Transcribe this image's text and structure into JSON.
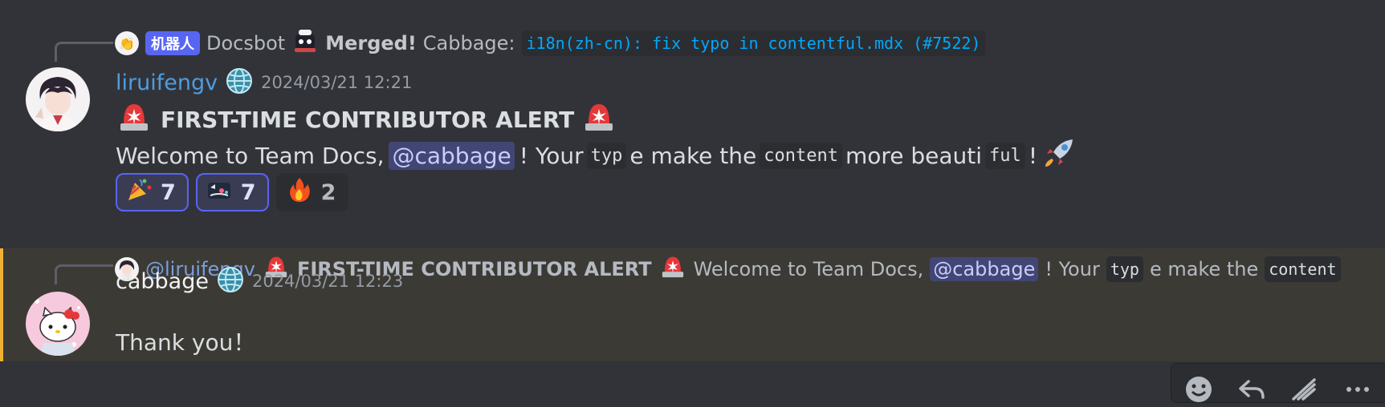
{
  "colors": {
    "background": "#323339",
    "highlight_bg": "#3c3a35",
    "highlight_bar": "#f0b232",
    "mention_bg": "#414675",
    "link_blue": "#00a8fc",
    "username_blue": "#4d9de0"
  },
  "message1": {
    "reply": {
      "bot_tag": "机器人",
      "author": "Docsbot",
      "merged": "Merged!",
      "prefix": "Cabbage:",
      "commit": "i18n(zh-cn): fix typo in contentful.mdx (#7522)"
    },
    "author": "liruifengv",
    "timestamp": "2024/03/21 12:21",
    "title": "FIRST-TIME CONTRIBUTOR ALERT",
    "body": {
      "part1": "Welcome to Team Docs,",
      "mention": "@cabbage",
      "part2": "! Your",
      "code1": "typ",
      "part3": "e make the",
      "code2": "content",
      "part4": "more beauti",
      "code3": "ful",
      "part5": "!"
    },
    "reactions": [
      {
        "emoji": "party-popper-icon",
        "count": "7",
        "active": true
      },
      {
        "emoji": "custom-emote-icon",
        "count": "7",
        "active": true
      },
      {
        "emoji": "fire-icon",
        "count": "2",
        "active": false
      }
    ]
  },
  "message2": {
    "reply": {
      "author": "@liruifengv",
      "title": "FIRST-TIME CONTRIBUTOR ALERT",
      "part1": "Welcome to Team Docs,",
      "mention": "@cabbage",
      "part2": "! Your",
      "code1": "typ",
      "part3": "e make the",
      "code2": "content"
    },
    "author": "cabbage",
    "timestamp": "2024/03/21 12:23",
    "body": "Thank you！"
  },
  "toolbar": [
    "emoji-icon",
    "reply-icon",
    "forward-icon",
    "more-icon"
  ]
}
